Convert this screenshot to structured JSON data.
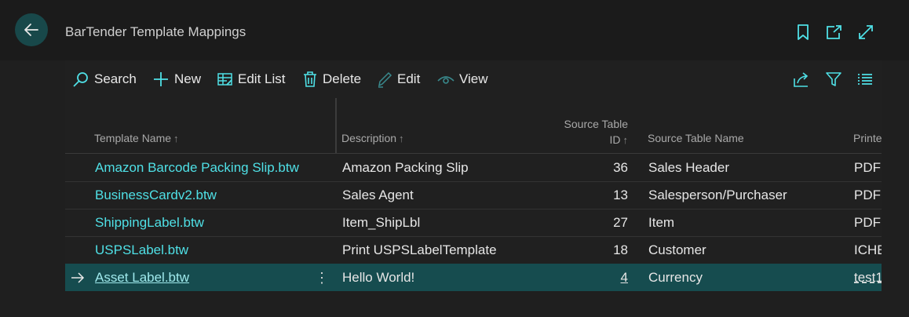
{
  "header": {
    "title": "BarTender Template Mappings"
  },
  "toolbar": {
    "search": "Search",
    "new": "New",
    "edit_list": "Edit List",
    "delete": "Delete",
    "edit": "Edit",
    "view": "View"
  },
  "columns": {
    "template_name": "Template Name",
    "description": "Description",
    "source_table_id_line1": "Source Table",
    "source_table_id_line2": "ID",
    "source_table_name": "Source Table Name",
    "printer": "Printe"
  },
  "rows": [
    {
      "template": "Amazon Barcode Packing Slip.btw",
      "description": "Amazon Packing Slip",
      "id": "36",
      "table": "Sales Header",
      "printer": "PDF"
    },
    {
      "template": "BusinessCardv2.btw",
      "description": "Sales Agent",
      "id": "13",
      "table": "Salesperson/Purchaser",
      "printer": "PDF"
    },
    {
      "template": "ShippingLabel.btw",
      "description": "Item_ShipLbl",
      "id": "27",
      "table": "Item",
      "printer": "PDF"
    },
    {
      "template": "USPSLabel.btw",
      "description": "Print USPSLabelTemplate",
      "id": "18",
      "table": "Customer",
      "printer": "ICHE"
    },
    {
      "template": "Asset Label.btw",
      "description": "Hello World!",
      "id": "4",
      "table": "Currency",
      "printer": "test1"
    }
  ],
  "colors": {
    "accent": "#4fe0e6",
    "selected_row": "#164c4f",
    "back_button": "#18484a"
  }
}
